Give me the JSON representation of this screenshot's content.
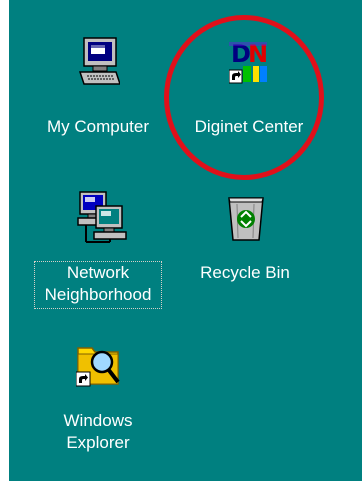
{
  "desktop": {
    "background": "#008080",
    "icons": [
      {
        "label": "My Computer",
        "icon": "my-computer-icon"
      },
      {
        "label": "Diginet Center",
        "icon": "diginet-center-icon",
        "shortcut": true,
        "logo_text": "DN"
      },
      {
        "label_lines": [
          "Network",
          "Neighborhood"
        ],
        "icon": "network-neighborhood-icon",
        "focused": true
      },
      {
        "label": "Recycle Bin",
        "icon": "recycle-bin-icon"
      },
      {
        "label_lines": [
          "Windows",
          "Explorer"
        ],
        "icon": "windows-explorer-icon",
        "shortcut": true
      }
    ]
  },
  "annotation": {
    "color": "#e0101a",
    "target": "Diginet Center"
  }
}
